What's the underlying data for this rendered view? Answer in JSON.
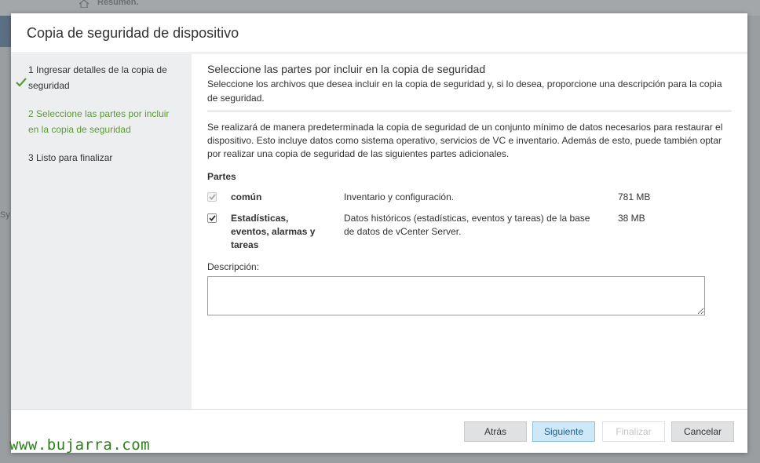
{
  "background": {
    "breadcrumb": "Resumen.",
    "side_text": "Sy"
  },
  "dialog": {
    "title": "Copia de seguridad de dispositivo"
  },
  "steps": [
    {
      "label": "1 Ingresar detalles de la copia de seguridad",
      "state": "completed"
    },
    {
      "label": "2 Seleccione las partes por incluir en la copia de seguridad",
      "state": "active"
    },
    {
      "label": "3 Listo para finalizar",
      "state": "pending"
    }
  ],
  "content": {
    "title": "Seleccione las partes por incluir en la copia de seguridad",
    "subtitle": "Seleccione los archivos que desea incluir en la copia de seguridad y, si lo desea, proporcione una descripción para la copia de seguridad.",
    "description": "Se realizará de manera predeterminada la copia de seguridad de un conjunto mínimo de datos necesarios para restaurar el dispositivo. Esto incluye datos como sistema operativo, servicios de VC e inventario. Además de esto, puede también optar por realizar una copia de seguridad de las siguientes partes adicionales.",
    "parts_label": "Partes",
    "parts": [
      {
        "name": "común",
        "description": "Inventario y configuración.",
        "size": "781 MB",
        "checked": true,
        "disabled": true
      },
      {
        "name": "Estadísticas, eventos, alarmas y tareas",
        "description": "Datos históricos (estadísticas, eventos y tareas) de la base de datos de vCenter Server.",
        "size": "38 MB",
        "checked": true,
        "disabled": false
      }
    ],
    "description_label": "Descripción:",
    "description_value": ""
  },
  "footer": {
    "back": "Atrás",
    "next": "Siguiente",
    "finish": "Finalizar",
    "cancel": "Cancelar"
  },
  "watermark": "www.bujarra.com",
  "colors": {
    "accent_green": "#5b9a34",
    "primary_button": "#cfe8f7",
    "steps_bg": "#eceeef"
  }
}
